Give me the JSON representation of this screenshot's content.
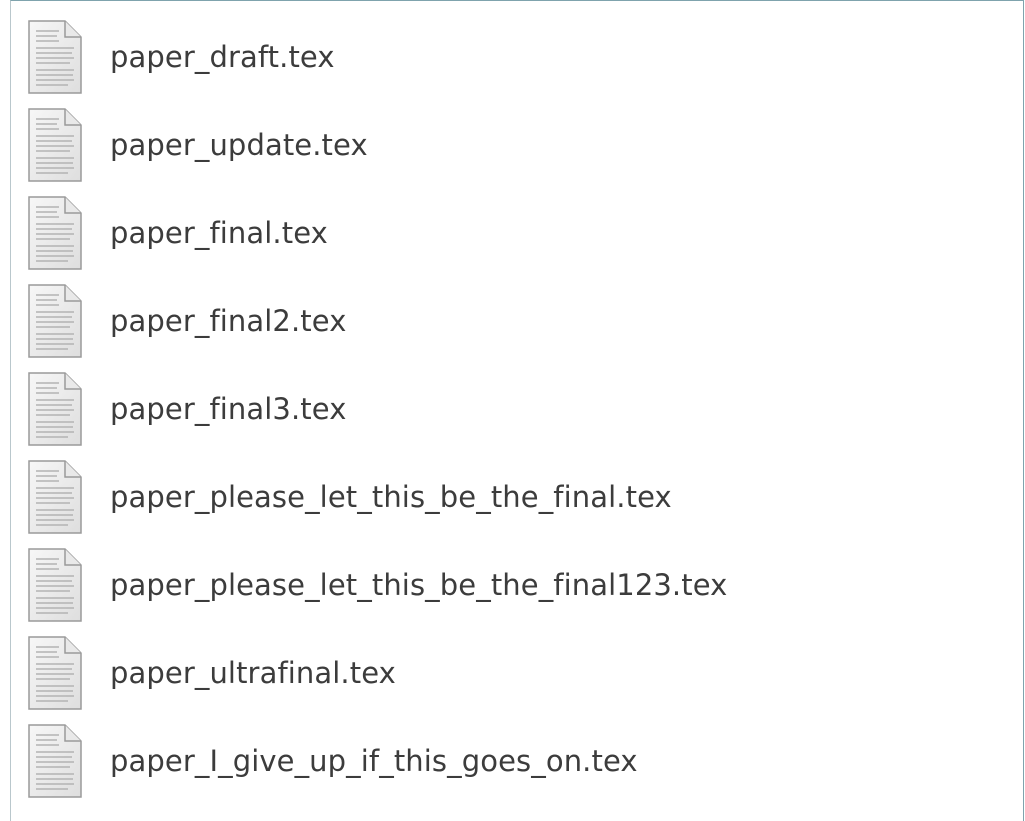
{
  "file_list": {
    "items": [
      {
        "name": "paper_draft.tex",
        "icon": "text-document-icon"
      },
      {
        "name": "paper_update.tex",
        "icon": "text-document-icon"
      },
      {
        "name": "paper_final.tex",
        "icon": "text-document-icon"
      },
      {
        "name": "paper_final2.tex",
        "icon": "text-document-icon"
      },
      {
        "name": "paper_final3.tex",
        "icon": "text-document-icon"
      },
      {
        "name": "paper_please_let_this_be_the_final.tex",
        "icon": "text-document-icon"
      },
      {
        "name": "paper_please_let_this_be_the_final123.tex",
        "icon": "text-document-icon"
      },
      {
        "name": "paper_ultrafinal.tex",
        "icon": "text-document-icon"
      },
      {
        "name": "paper_I_give_up_if_this_goes_on.tex",
        "icon": "text-document-icon"
      }
    ]
  }
}
